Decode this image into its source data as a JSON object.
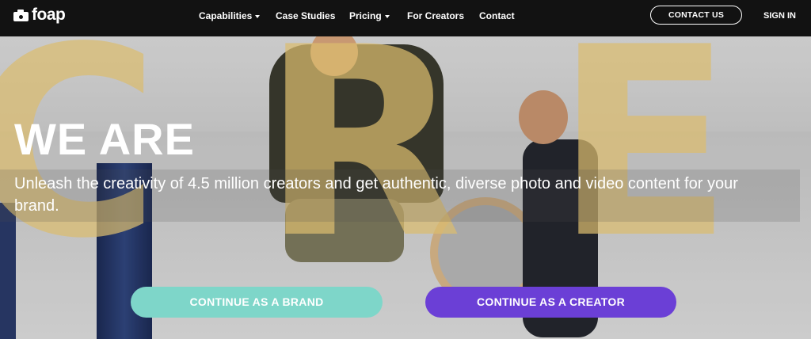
{
  "nav": {
    "logo_text": "foap",
    "items": [
      {
        "label": "Capabilities",
        "has_dropdown": true
      },
      {
        "label": "Case Studies",
        "has_dropdown": false
      },
      {
        "label": "Pricing",
        "has_dropdown": true
      },
      {
        "label": "For Creators",
        "has_dropdown": false
      },
      {
        "label": "Contact",
        "has_dropdown": false
      }
    ],
    "contact_button": "CONTACT US",
    "sign_in": "SIGN IN"
  },
  "hero": {
    "headline": "WE ARE",
    "background_word": "CREATIVE",
    "subtitle": "Unleash the creativity of 4.5 million creators and get authentic, diverse photo and video content for your brand.",
    "buttons": {
      "brand": "CONTINUE AS A BRAND",
      "creator": "CONTINUE AS A CREATOR"
    }
  },
  "colors": {
    "nav_bg": "#121212",
    "brand_button": "#7ed6c9",
    "creator_button": "#6b3fd6",
    "letter_overlay": "#eecd78"
  },
  "icons": {
    "logo": "camera-icon",
    "dropdown": "caret-down-icon"
  }
}
